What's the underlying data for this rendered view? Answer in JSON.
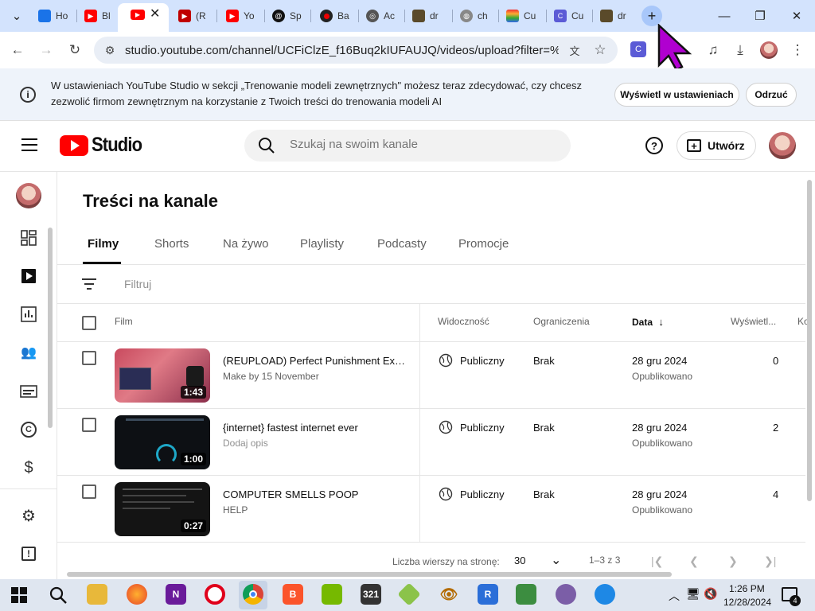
{
  "browser": {
    "tabs": [
      {
        "label": "Ho",
        "icon": "blue-app-icon",
        "color": "#1a73e8"
      },
      {
        "label": "Bl",
        "icon": "youtube-icon",
        "color": "#ff0000"
      },
      {
        "label": "",
        "icon": "youtube-icon",
        "color": "#ff0000",
        "active": true
      },
      {
        "label": "(R",
        "icon": "youtube-icon",
        "color": "#c00000"
      },
      {
        "label": "Yo",
        "icon": "youtube-icon",
        "color": "#ff0000"
      },
      {
        "label": "Sp",
        "icon": "circle-logo-icon",
        "color": "#111111"
      },
      {
        "label": "Ba",
        "icon": "red-dot-icon",
        "color": "#cc0000"
      },
      {
        "label": "Ac",
        "icon": "ac-logo-icon",
        "color": "#444444"
      },
      {
        "label": "dr",
        "icon": "image-thumb-icon",
        "color": "#5a4a2a"
      },
      {
        "label": "ch",
        "icon": "globe-icon",
        "color": "#777777"
      },
      {
        "label": "Cu",
        "icon": "rainbow-icon",
        "color": "#e08030"
      },
      {
        "label": "Cu",
        "icon": "purple-app-icon",
        "color": "#5b5bd6"
      },
      {
        "label": "dr",
        "icon": "image-thumb-icon",
        "color": "#5a4a2a"
      }
    ],
    "new_tab": "+",
    "url": "studio.youtube.com/channel/UCFiClzE_f16Buq2kIUFAUJQ/videos/upload?filter=%5B%..."
  },
  "banner": {
    "text": "W ustawieniach YouTube Studio w sekcji „Trenowanie modeli zewnętrznych\" możesz teraz zdecydować, czy chcesz zezwolić firmom zewnętrznym na korzystanie z Twoich treści do trenowania modeli AI",
    "view_button": "Wyświetl w ustawieniach",
    "dismiss_button": "Odrzuć"
  },
  "header": {
    "logo": "Studio",
    "search_placeholder": "Szukaj na swoim kanale",
    "create_label": "Utwórz"
  },
  "page": {
    "title": "Treści na kanale",
    "tabs": [
      "Filmy",
      "Shorts",
      "Na żywo",
      "Playlisty",
      "Podcasty",
      "Promocje"
    ],
    "filter_label": "Filtruj"
  },
  "table": {
    "columns": {
      "film": "Film",
      "visibility": "Widoczność",
      "restrictions": "Ograniczenia",
      "date": "Data",
      "views": "Wyświetl...",
      "comments": "Ko"
    },
    "rows": [
      {
        "title": "(REUPLOAD) Perfect Punishment Exe...",
        "description": "Make by 15 November",
        "duration": "1:43",
        "visibility": "Publiczny",
        "restrictions": "Brak",
        "date": "28 gru 2024",
        "status": "Opublikowano",
        "views": "0"
      },
      {
        "title": "{internet} fastest internet ever",
        "description": "Dodaj opis",
        "duration": "1:00",
        "visibility": "Publiczny",
        "restrictions": "Brak",
        "date": "28 gru 2024",
        "status": "Opublikowano",
        "views": "2"
      },
      {
        "title": "COMPUTER SMELLS POOP",
        "description": "HELP",
        "duration": "0:27",
        "visibility": "Publiczny",
        "restrictions": "Brak",
        "date": "28 gru 2024",
        "status": "Opublikowano",
        "views": "4"
      }
    ]
  },
  "pagination": {
    "rows_label": "Liczba wierszy na stronę:",
    "rows_value": "30",
    "range": "1–3 z 3"
  },
  "taskbar": {
    "time": "1:26 PM",
    "date": "12/28/2024",
    "notifications": "4"
  },
  "colors": {
    "youtube_red": "#ff0000",
    "tabstrip_bg": "#d3e3fd",
    "banner_bg": "#eef3fa",
    "cursor": "#b000d0"
  }
}
